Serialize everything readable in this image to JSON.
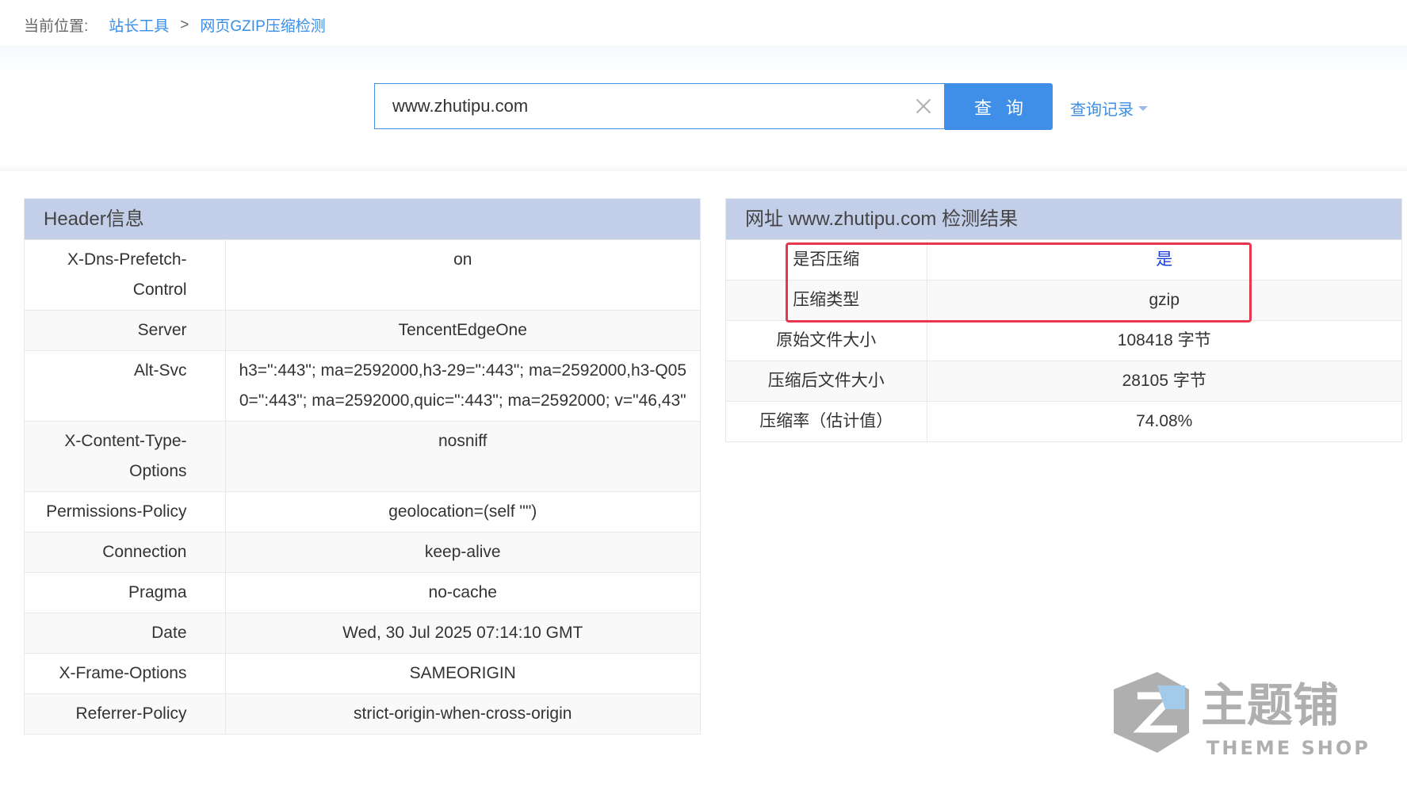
{
  "breadcrumb": {
    "prefix": "当前位置:",
    "tools": "站长工具",
    "separator": ">",
    "current": "网页GZIP压缩检测"
  },
  "search": {
    "value": "www.zhutipu.com",
    "button": "查询",
    "history": "查询记录"
  },
  "header_panel": {
    "title": "Header信息",
    "rows": [
      {
        "k": "X-Dns-Prefetch-Control",
        "v": "on"
      },
      {
        "k": "Server",
        "v": "TencentEdgeOne"
      },
      {
        "k": "Alt-Svc",
        "v": "h3=\":443\"; ma=2592000,h3-29=\":443\"; ma=2592000,h3-Q050=\":443\"; ma=2592000,quic=\":443\"; ma=2592000; v=\"46,43\""
      },
      {
        "k": "X-Content-Type-Options",
        "v": "nosniff"
      },
      {
        "k": "Permissions-Policy",
        "v": "geolocation=(self \"\")"
      },
      {
        "k": "Connection",
        "v": "keep-alive"
      },
      {
        "k": "Pragma",
        "v": "no-cache"
      },
      {
        "k": "Date",
        "v": "Wed, 30 Jul 2025 07:14:10 GMT"
      },
      {
        "k": "X-Frame-Options",
        "v": "SAMEORIGIN"
      },
      {
        "k": "Referrer-Policy",
        "v": "strict-origin-when-cross-origin"
      }
    ]
  },
  "result_panel": {
    "title": "网址 www.zhutipu.com 检测结果",
    "rows": [
      {
        "k": "是否压缩",
        "v": "是"
      },
      {
        "k": "压缩类型",
        "v": "gzip"
      },
      {
        "k": "原始文件大小",
        "v": "108418 字节"
      },
      {
        "k": "压缩后文件大小",
        "v": "28105 字节"
      },
      {
        "k": "压缩率（估计值）",
        "v": "74.08%"
      }
    ]
  },
  "watermark": {
    "brand": "主题铺",
    "sub": "THEME SHOP"
  },
  "colors": {
    "accent": "#3f8fe8",
    "link": "#3a8ee6",
    "panel_header": "#c3cee8",
    "highlight": "#e8364f",
    "yes_text": "#1a3fd6"
  }
}
